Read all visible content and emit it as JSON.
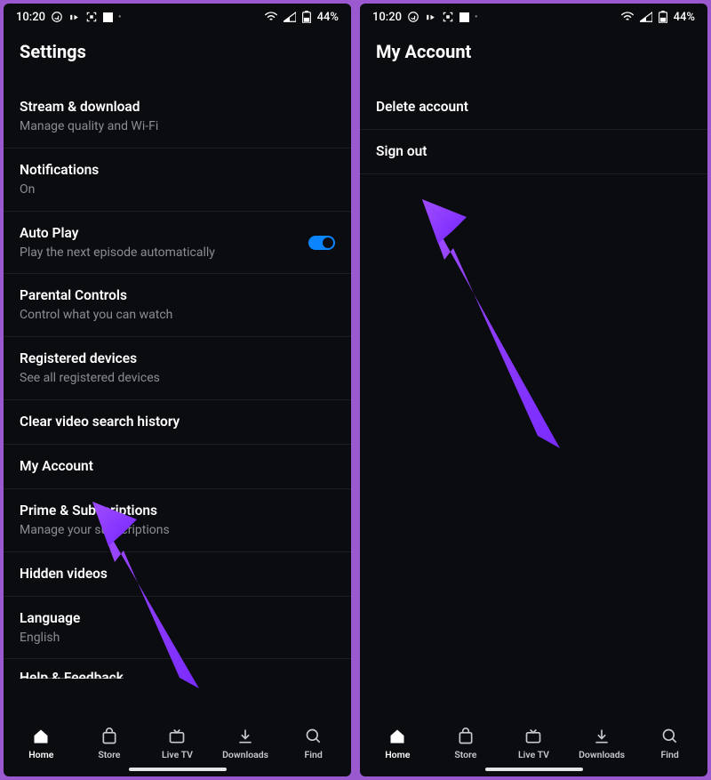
{
  "statusbar": {
    "time": "10:20",
    "battery": "44%"
  },
  "screens": {
    "settings": {
      "title": "Settings",
      "items": [
        {
          "title": "Stream & download",
          "sub": "Manage quality and Wi-Fi"
        },
        {
          "title": "Notifications",
          "sub": "On"
        },
        {
          "title": "Auto Play",
          "sub": "Play the next episode automatically",
          "toggle": true
        },
        {
          "title": "Parental Controls",
          "sub": "Control what you can watch"
        },
        {
          "title": "Registered devices",
          "sub": "See all registered devices"
        },
        {
          "title": "Clear video search history"
        },
        {
          "title": "My Account"
        },
        {
          "title": "Prime & Subscriptions",
          "sub": "Manage your subscriptions"
        },
        {
          "title": "Hidden videos"
        },
        {
          "title": "Language",
          "sub": "English"
        }
      ],
      "cutoff": "Help & Feedback"
    },
    "account": {
      "title": "My Account",
      "items": [
        {
          "title": "Delete account"
        },
        {
          "title": "Sign out"
        }
      ]
    }
  },
  "nav": {
    "items": [
      {
        "label": "Home"
      },
      {
        "label": "Store"
      },
      {
        "label": "Live TV"
      },
      {
        "label": "Downloads"
      },
      {
        "label": "Find"
      }
    ]
  }
}
